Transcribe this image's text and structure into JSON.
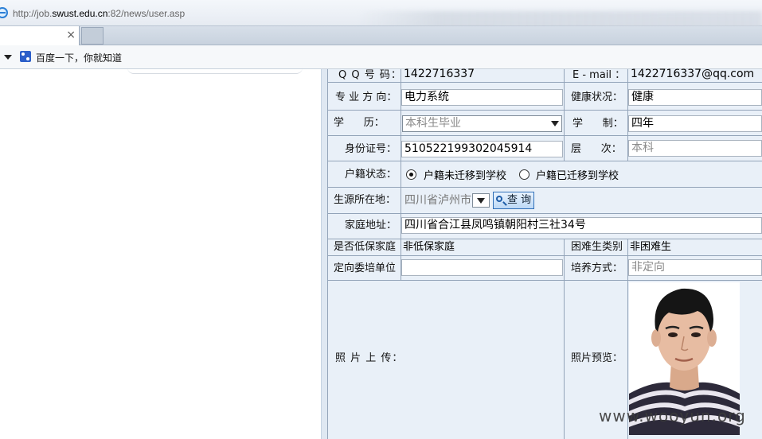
{
  "browser": {
    "url_prefix": "http://job.",
    "url_domain": "swust.edu.cn",
    "url_rest": ":82/news/user.asp",
    "tab_close": "×",
    "favorite_label": "百度一下，你就知道"
  },
  "form": {
    "qq_label": "Q Q 号 码：",
    "qq_value": "1422716337",
    "email_label": "E - mail ：",
    "email_value": "1422716337@qq.com",
    "major_label": "专 业 方 向：",
    "major_value": "电力系统",
    "health_label": "健康状况：",
    "health_value": "健康",
    "education_label": "学      历：",
    "education_value": "本科生毕业",
    "degree_label": "学      制：",
    "degree_value": "四年",
    "id_label": "身份证号：",
    "id_value": "510522199302045914",
    "level_label": "层      次：",
    "level_value": "本科",
    "hukou_label": "户籍状态：",
    "hukou_option1": "户籍未迁移到学校",
    "hukou_option2": "户籍已迁移到学校",
    "origin_label": "生源所在地：",
    "origin_value": "四川省泸州市",
    "query_button": "查 询",
    "address_label": "家庭地址：",
    "address_value": "四川省合江县凤鸣镇朝阳村三社34号",
    "lowincome_label": "是否低保家庭",
    "lowincome_value": "非低保家庭",
    "hardship_label": "困难生类别",
    "hardship_value": "非困难生",
    "directed_label": "定向委培单位",
    "directed_value": "",
    "training_label": "培养方式：",
    "training_value": "非定向",
    "photo_upload_label": "照 片 上 传：",
    "photo_preview_label": "照片预览："
  },
  "watermark": "www.wooyun.org",
  "colors": {
    "form_bg": "#e9f0f8",
    "grid_line": "#93a4b9",
    "query_border": "#2f6fb8"
  }
}
